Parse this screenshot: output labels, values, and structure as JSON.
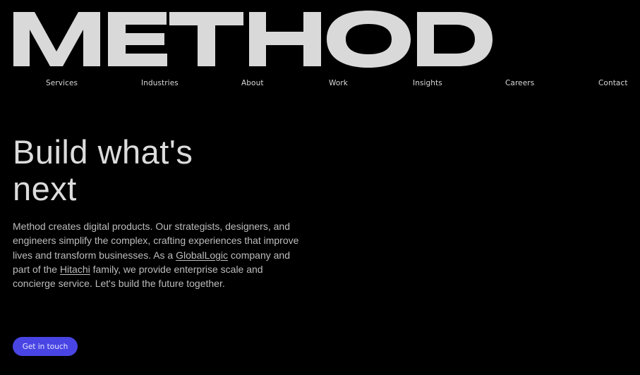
{
  "brand": {
    "logo_text": "METHOD",
    "logo_color": "#d9d9d9"
  },
  "nav": {
    "items": [
      {
        "label": "Services"
      },
      {
        "label": "Industries"
      },
      {
        "label": "About"
      },
      {
        "label": "Work"
      },
      {
        "label": "Insights"
      },
      {
        "label": "Careers"
      },
      {
        "label": "Contact"
      }
    ]
  },
  "hero": {
    "title_line1": "Build what's",
    "title_line2": "next",
    "copy_part1": "Method creates digital products. Our strategists, designers, and engineers simplify the complex, crafting experiences that improve lives and transform businesses. As a ",
    "link1": "GlobalLogic",
    "copy_part2": " company and part of the ",
    "link2": "Hitachi",
    "copy_part3": " family, we provide enterprise scale and concierge service. Let's build the future together.",
    "cta_label": "Get in touch",
    "cta_color": "#4945e4"
  }
}
